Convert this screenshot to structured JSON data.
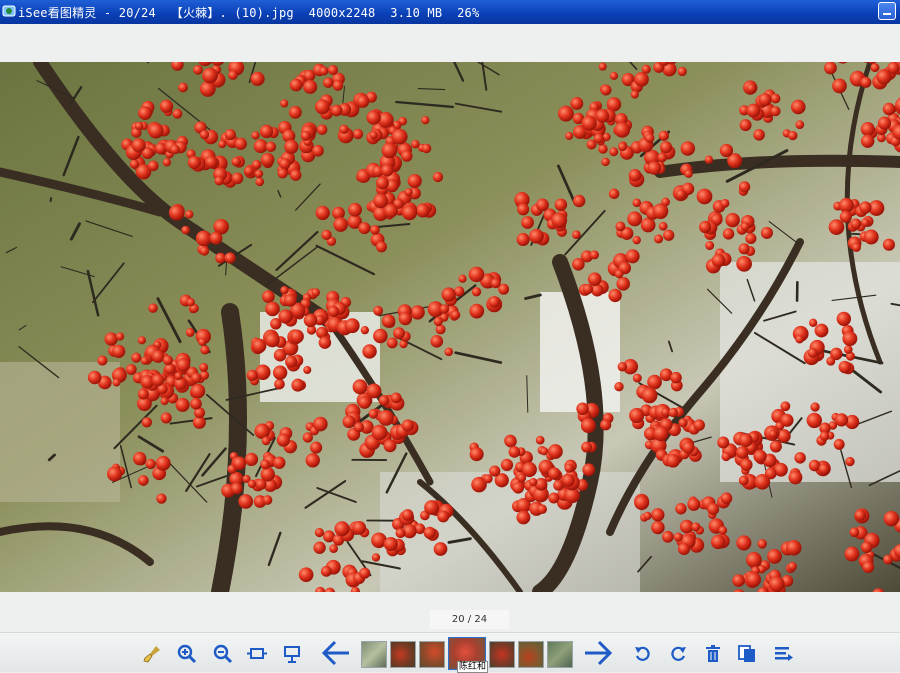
{
  "window": {
    "title": "iSee看图精灵 - 20/24  【火棘】. (10).jpg  4000x2248  3.10 MB  26%"
  },
  "viewer": {
    "image_subject": "firethorn-berries-photo"
  },
  "status": {
    "counter": "20 / 24"
  },
  "toolbar": {
    "tools": [
      {
        "name": "clean-brush-icon"
      },
      {
        "name": "zoom-in-icon"
      },
      {
        "name": "zoom-out-icon"
      },
      {
        "name": "fit-window-icon"
      },
      {
        "name": "slideshow-icon"
      }
    ],
    "right_tools": [
      {
        "name": "rotate-left-icon"
      },
      {
        "name": "rotate-right-icon"
      },
      {
        "name": "delete-icon"
      },
      {
        "name": "copy-icon"
      },
      {
        "name": "properties-icon"
      }
    ],
    "thumb_caption": "陈红和"
  },
  "colors": {
    "title_bar": "#0a3fb5",
    "accent_blue": "#1e5bc6",
    "berry_red": "#d8321f"
  }
}
